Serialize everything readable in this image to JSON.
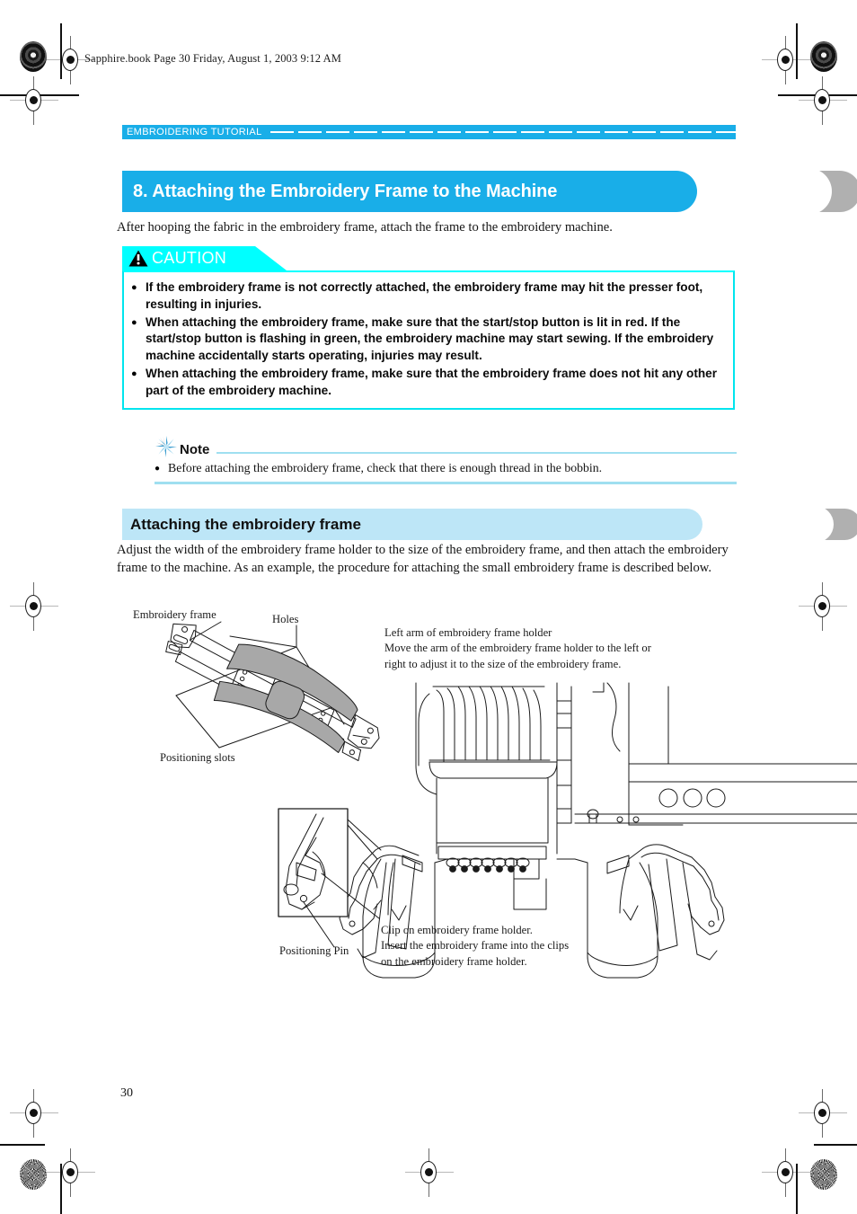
{
  "book_info": "Sapphire.book  Page 30  Friday, August 1, 2003  9:12 AM",
  "running_head": "EMBROIDERING TUTORIAL",
  "chapter_title": "8. Attaching the Embroidery Frame to the Machine",
  "intro": "After hooping the fabric in the embroidery frame, attach the frame to the embroidery machine.",
  "caution": {
    "label": "CAUTION",
    "icon": "warning-triangle-icon",
    "items": [
      "If the embroidery frame is not correctly attached, the embroidery frame may hit the presser foot, resulting in injuries.",
      "When attaching the embroidery frame, make sure that the start/stop button is lit in red. If the start/stop button is flashing in green, the embroidery machine may start sewing. If the embroidery machine accidentally starts operating, injuries may result.",
      "When attaching the embroidery frame, make sure that the embroidery frame does not hit any other part of the embroidery machine."
    ]
  },
  "note": {
    "label": "Note",
    "icon": "starburst-icon",
    "items": [
      "Before attaching the embroidery frame, check that there is enough thread in the bobbin."
    ]
  },
  "subsection": {
    "title": "Attaching the embroidery frame",
    "intro": "Adjust the width of the embroidery frame holder to the size of the embroidery frame, and then attach the embroidery frame to the machine. As an example, the procedure for attaching the small embroidery frame is described below."
  },
  "figure": {
    "labels": {
      "embroidery_frame": "Embroidery frame",
      "holes": "Holes",
      "positioning_slots": "Positioning slots",
      "positioning_pin": "Positioning Pin",
      "left_arm": "Left arm of embroidery frame holder\nMove the arm of the embroidery frame holder to the left or\nright to adjust it to the size of the embroidery frame.",
      "clip": "Clip on embroidery frame holder.\nInsert the embroidery frame into the clips\non the embroidery frame holder."
    }
  },
  "page_number": "30",
  "colors": {
    "accent_blue": "#19aee8",
    "light_blue": "#bde6f7",
    "caution_cyan": "#00ffff",
    "note_rule": "#9fdff0",
    "shadow_gray": "#b0b0b0"
  }
}
